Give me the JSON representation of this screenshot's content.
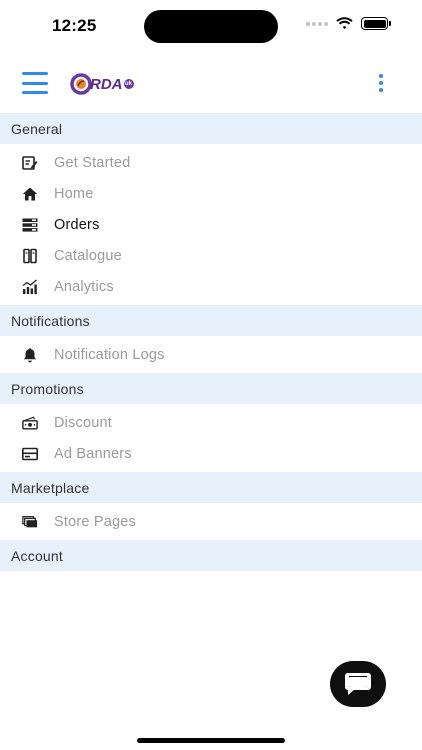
{
  "status_bar": {
    "time": "12:25"
  },
  "header": {
    "logo_text": "RDA",
    "logo_badge": "uk"
  },
  "menu": {
    "sections": [
      {
        "title": "General",
        "items": [
          {
            "label": "Get Started",
            "icon": "edit-note-icon"
          },
          {
            "label": "Home",
            "icon": "home-icon"
          },
          {
            "label": "Orders",
            "icon": "orders-icon",
            "active": true
          },
          {
            "label": "Catalogue",
            "icon": "catalogue-icon"
          },
          {
            "label": "Analytics",
            "icon": "analytics-icon"
          }
        ]
      },
      {
        "title": "Notifications",
        "items": [
          {
            "label": "Notification Logs",
            "icon": "bell-icon"
          }
        ]
      },
      {
        "title": "Promotions",
        "items": [
          {
            "label": "Discount",
            "icon": "money-icon"
          },
          {
            "label": "Ad Banners",
            "icon": "banner-icon"
          }
        ]
      },
      {
        "title": "Marketplace",
        "items": [
          {
            "label": "Store Pages",
            "icon": "store-pages-icon"
          }
        ]
      },
      {
        "title": "Account",
        "items": []
      }
    ]
  },
  "colors": {
    "accent": "#2f8be6",
    "section_bg": "#e6f1fc",
    "inactive_text": "#9a9a9a",
    "active_text": "#111111",
    "fab_bg": "#0f0f0f"
  }
}
